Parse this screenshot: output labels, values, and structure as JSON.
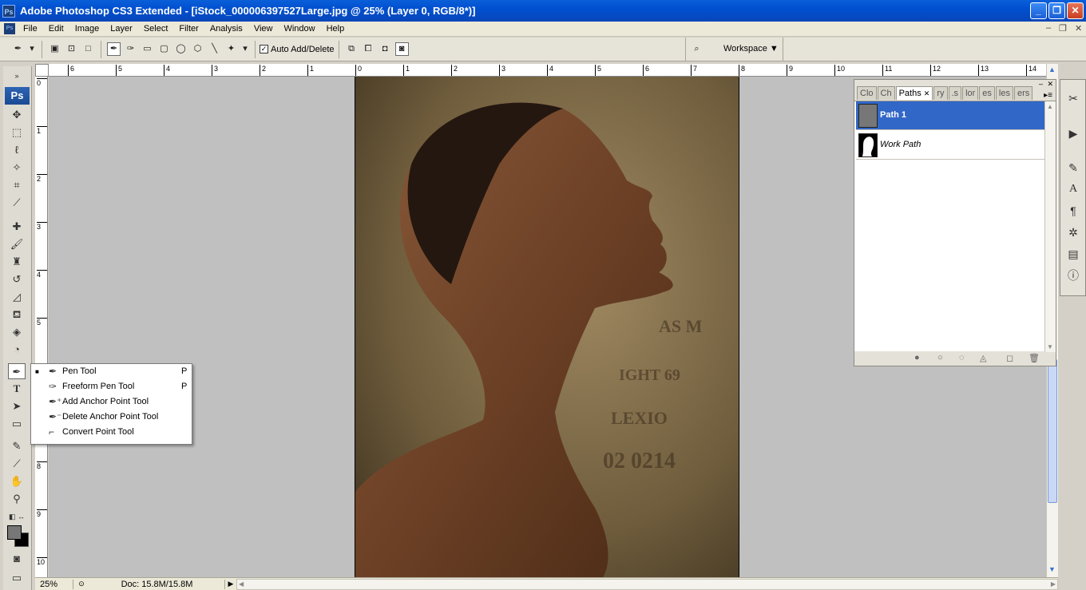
{
  "window": {
    "title": "Adobe Photoshop CS3 Extended - [iStock_000006397527Large.jpg @ 25% (Layer 0, RGB/8*)]",
    "icon": "ps-app-icon"
  },
  "menu": [
    "File",
    "Edit",
    "Image",
    "Layer",
    "Select",
    "Filter",
    "Analysis",
    "View",
    "Window",
    "Help"
  ],
  "options": {
    "auto_add_delete_label": "Auto Add/Delete",
    "auto_add_delete_checked": true,
    "workspace_label": "Workspace"
  },
  "toolbox": {
    "logo": "Ps"
  },
  "ruler_h": [
    "6",
    "5",
    "4",
    "3",
    "2",
    "1",
    "0",
    "1",
    "2",
    "3",
    "4",
    "5",
    "6",
    "7",
    "8",
    "9",
    "10",
    "11",
    "12",
    "13",
    "14"
  ],
  "ruler_v": [
    "0",
    "1",
    "2",
    "3",
    "4",
    "5",
    "6",
    "7",
    "8",
    "9",
    "10"
  ],
  "flyout": {
    "items": [
      {
        "label": "Pen Tool",
        "key": "P",
        "selected": true,
        "icon": "pen-icon"
      },
      {
        "label": "Freeform Pen Tool",
        "key": "P",
        "selected": false,
        "icon": "freeform-pen-icon"
      },
      {
        "label": "Add Anchor Point Tool",
        "key": "",
        "selected": false,
        "icon": "add-anchor-icon"
      },
      {
        "label": "Delete Anchor Point Tool",
        "key": "",
        "selected": false,
        "icon": "delete-anchor-icon"
      },
      {
        "label": "Convert Point Tool",
        "key": "",
        "selected": false,
        "icon": "convert-point-icon"
      }
    ]
  },
  "paths_panel": {
    "tabs": [
      "Clo",
      "Ch",
      "Paths",
      "ry",
      ".s",
      "lor",
      "es",
      "les",
      "ers"
    ],
    "active_tab": "Paths",
    "paths": [
      {
        "name": "Path 1",
        "selected": true
      },
      {
        "name": "Work Path",
        "selected": false
      }
    ]
  },
  "status": {
    "zoom": "25%",
    "doc": "Doc: 15.8M/15.8M"
  }
}
